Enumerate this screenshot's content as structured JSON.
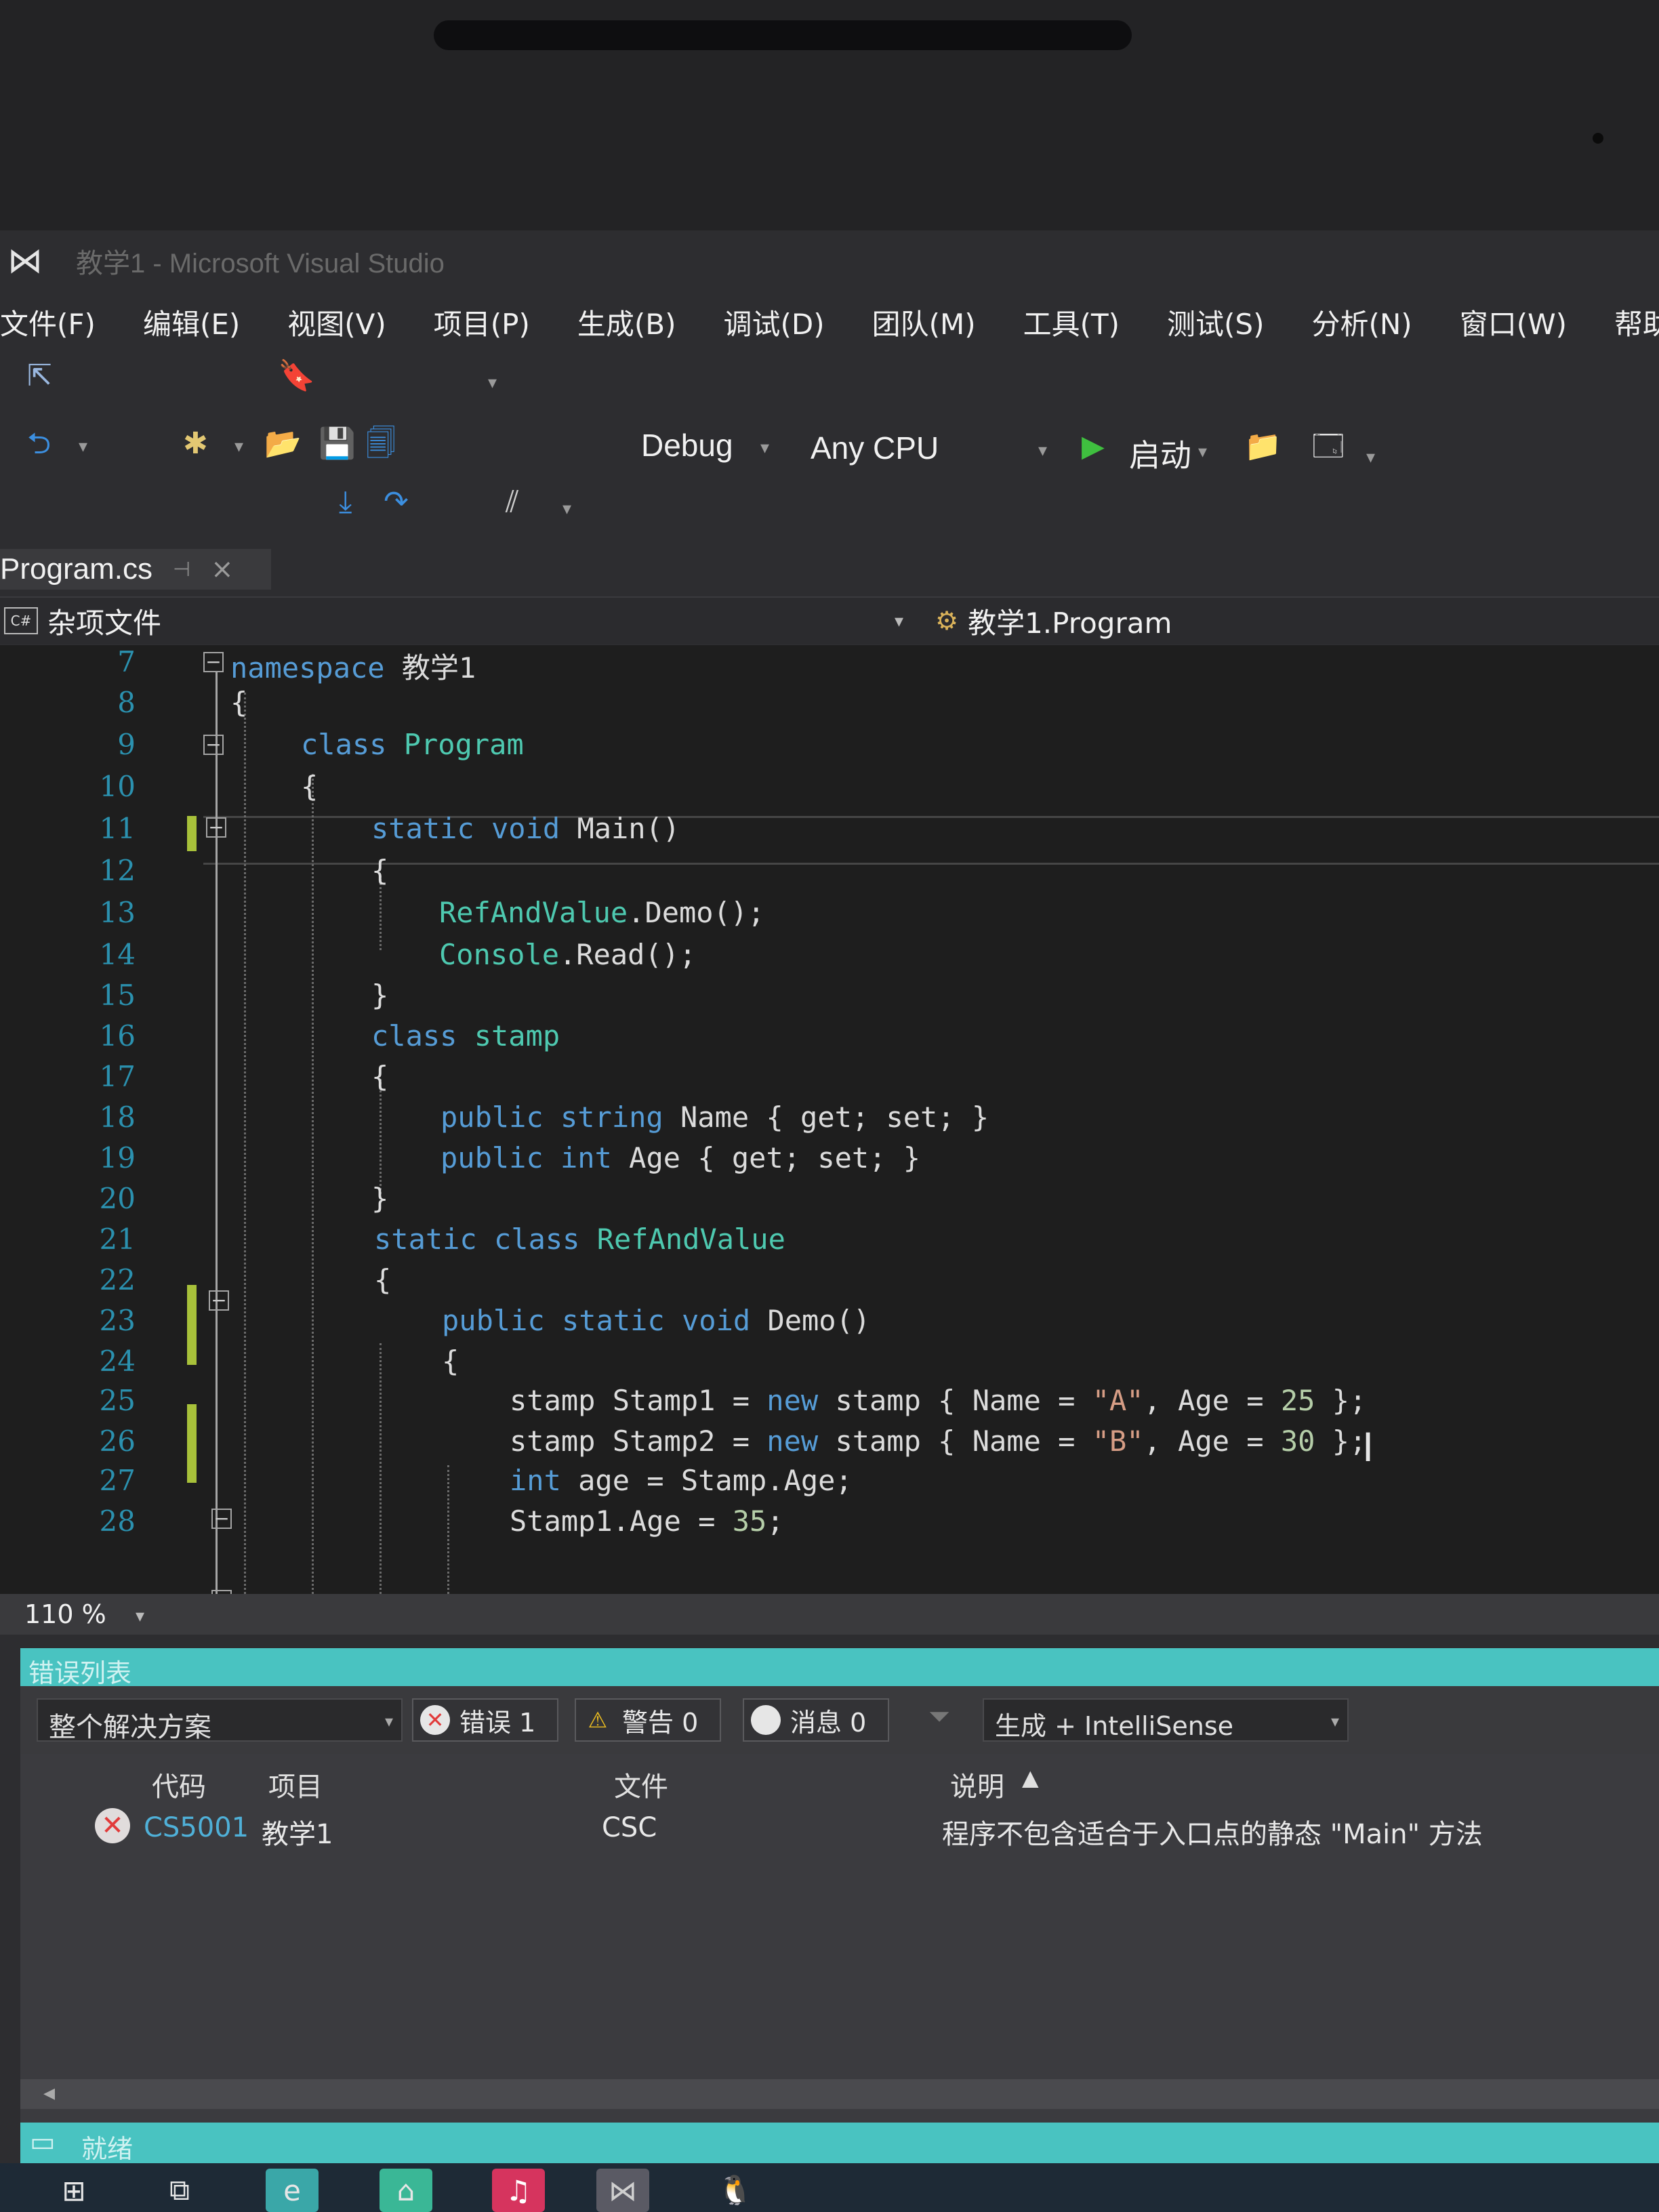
{
  "window": {
    "title": "教学1 - Microsoft Visual Studio",
    "logo_icon": "vs-logo-icon"
  },
  "menu": [
    "文件(F)",
    "编辑(E)",
    "视图(V)",
    "项目(P)",
    "生成(B)",
    "调试(D)",
    "团队(M)",
    "工具(T)",
    "测试(S)",
    "分析(N)",
    "窗口(W)",
    "帮助(H)"
  ],
  "toolbar": {
    "config": "Debug",
    "platform": "Any CPU",
    "start_label": "启动"
  },
  "tab": {
    "name": "Program.cs"
  },
  "nav": {
    "scope": "杂项文件",
    "cs_badge": "C#",
    "member": "教学1.Program"
  },
  "line_numbers": [
    "7",
    "8",
    "9",
    "10",
    "11",
    "12",
    "13",
    "14",
    "15",
    "16",
    "17",
    "18",
    "19",
    "20",
    "21",
    "22",
    "23",
    "24",
    "25",
    "26",
    "27",
    "28"
  ],
  "code": {
    "l7": {
      "kw": "namespace",
      "name": " 教学1"
    },
    "l8": "{",
    "l9": {
      "kw": "class",
      "name": "Program"
    },
    "l10": "{",
    "l11": {
      "kw": "static void",
      "name": " Main()"
    },
    "l12": "{",
    "l13": {
      "obj": "RefAndValue",
      "rest": ".Demo();"
    },
    "l14": {
      "obj": "Console",
      "rest": ".Read();"
    },
    "l15": "}",
    "l16": {
      "kw": "class",
      "name": " stamp"
    },
    "l17": "{",
    "l18": {
      "kw": "public string",
      "name": " Name",
      "rest": " { get; set; }"
    },
    "l19": {
      "kw": "public int",
      "name": " Age",
      "rest": " { get; set; }"
    },
    "l20": "}",
    "l21": {
      "kw": "static class",
      "name": " RefAndValue"
    },
    "l22": "{",
    "l23": {
      "kw": "public static void",
      "name": " Demo()"
    },
    "l24": "{",
    "l25": {
      "a": "stamp Stamp1 = ",
      "kw": "new",
      "b": " stamp { Name = ",
      "s": "\"A\"",
      "c": ", Age = ",
      "n": "25",
      "d": " };"
    },
    "l26": {
      "a": "stamp Stamp2 = ",
      "kw": "new",
      "b": " stamp { Name = ",
      "s": "\"B\"",
      "c": ", Age = ",
      "n": "30",
      "d": " };"
    },
    "l27": {
      "kw": "int",
      "rest": " age = Stamp.Age;"
    },
    "l28": {
      "rest": "Stamp1.Age = ",
      "n": "35",
      "end": ";"
    }
  },
  "zoom": "110 %",
  "error_list": {
    "title": "错误列表",
    "scope": "整个解决方案",
    "filters": {
      "errors": "错误 1",
      "warnings": "警告 0",
      "messages": "消息 0"
    },
    "build_filter": "生成 + IntelliSense",
    "columns": {
      "code": "代码",
      "project": "项目",
      "file": "文件",
      "desc": "说明"
    },
    "rows": [
      {
        "code": "CS5001",
        "project": "教学1",
        "file": "CSC",
        "desc": "程序不包含适合于入口点的静态 \"Main\" 方法"
      }
    ]
  },
  "status": "就绪",
  "colors": {
    "accent": "#49c3c1",
    "keyword": "#569cd6",
    "type": "#4ec9b0",
    "string": "#d69d85",
    "linenum": "#2b91af",
    "error": "#e13a3a"
  }
}
